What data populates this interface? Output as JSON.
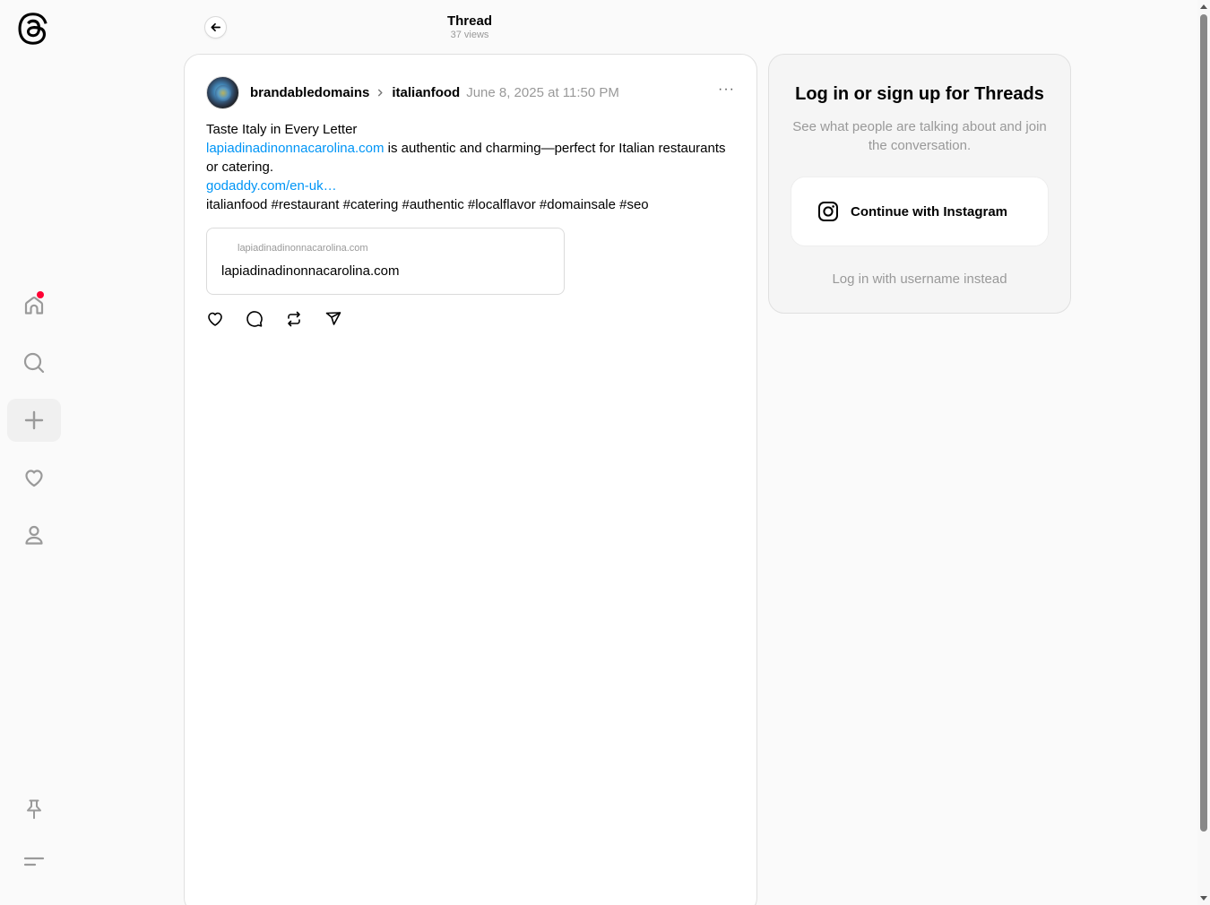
{
  "header": {
    "title": "Thread",
    "views": "37 views"
  },
  "post": {
    "username": "brandabledomains",
    "topic": "italianfood",
    "timestamp": "June 8, 2025 at 11:50 PM",
    "more": "···",
    "line1": "Taste Italy in Every Letter",
    "link1": "lapiadinadinonnacarolina.com",
    "line2_rest": " is authentic and charming—perfect for Italian restaurants or catering.",
    "link2": "godaddy.com/en-uk…",
    "hashtags": "italianfood #restaurant #catering #authentic #localflavor #domainsale #seo",
    "link_card": {
      "domain": "lapiadinadinonnacarolina.com",
      "title": "lapiadinadinonnacarolina.com"
    }
  },
  "login": {
    "title": "Log in or sign up for Threads",
    "subtitle": "See what people are talking about and join the conversation.",
    "instagram_button": "Continue with Instagram",
    "username_link": "Log in with username instead"
  },
  "colors": {
    "link": "#0095f6",
    "notification_dot": "#ff0034"
  }
}
